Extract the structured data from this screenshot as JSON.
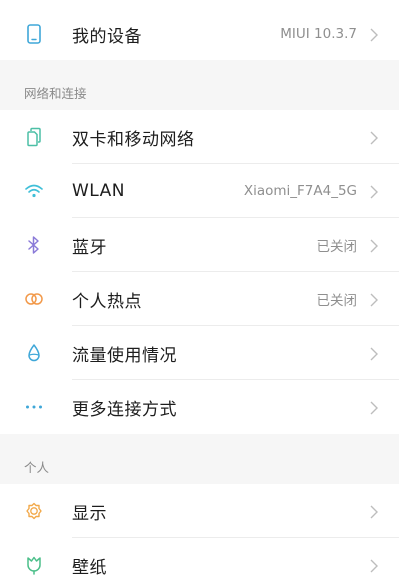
{
  "device": {
    "label": "我的设备",
    "value": "MIUI 10.3.7",
    "icon": "phone-icon"
  },
  "sections": {
    "network": {
      "header": "网络和连接",
      "items": [
        {
          "label": "双卡和移动网络",
          "value": "",
          "icon": "sim-cards-icon",
          "color": "#4cbfa6"
        },
        {
          "label": "WLAN",
          "value": "Xiaomi_F7A4_5G",
          "icon": "wifi-icon",
          "color": "#3fbfd8"
        },
        {
          "label": "蓝牙",
          "value": "已关闭",
          "icon": "bluetooth-icon",
          "color": "#8a7ad8"
        },
        {
          "label": "个人热点",
          "value": "已关闭",
          "icon": "hotspot-icon",
          "color": "#f2994a"
        },
        {
          "label": "流量使用情况",
          "value": "",
          "icon": "data-drop-icon",
          "color": "#3fa7d8"
        },
        {
          "label": "更多连接方式",
          "value": "",
          "icon": "more-dots-icon",
          "color": "#3fa7d8"
        }
      ]
    },
    "personal": {
      "header": "个人",
      "items": [
        {
          "label": "显示",
          "value": "",
          "icon": "sun-icon",
          "color": "#f2a94a"
        },
        {
          "label": "壁纸",
          "value": "",
          "icon": "wallpaper-tulip-icon",
          "color": "#4cbf8a"
        }
      ]
    }
  }
}
